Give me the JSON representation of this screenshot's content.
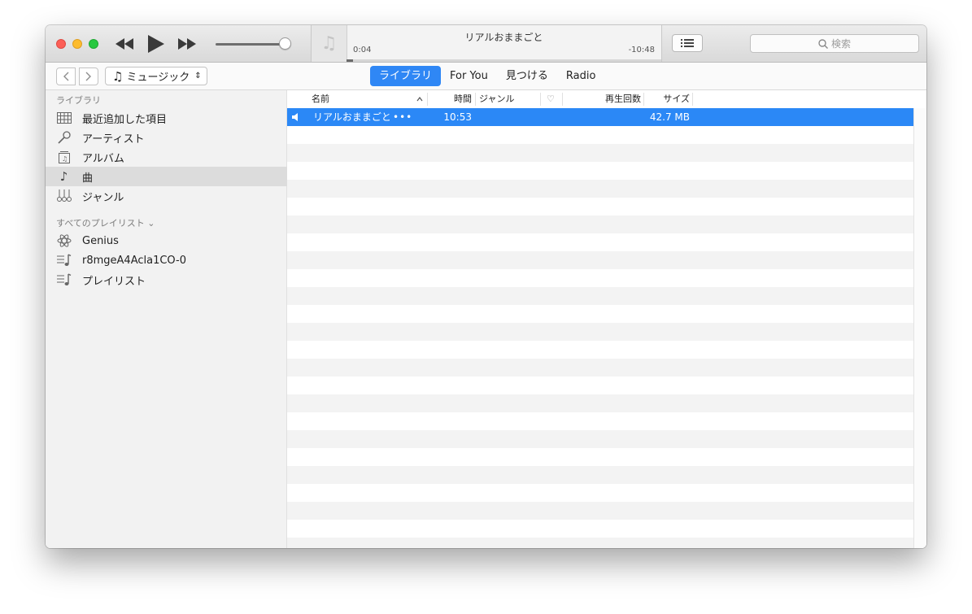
{
  "player": {
    "now_playing_title": "リアルおままごと",
    "elapsed": "0:04",
    "remaining": "-10:48",
    "progress": 0.006,
    "volume": 0.9
  },
  "search": {
    "placeholder": "検索"
  },
  "nav": {
    "media_kind": "ミュージック",
    "tabs": [
      {
        "label": "ライブラリ",
        "active": true
      },
      {
        "label": "For You",
        "active": false
      },
      {
        "label": "見つける",
        "active": false
      },
      {
        "label": "Radio",
        "active": false
      }
    ]
  },
  "sidebar": {
    "library_header": "ライブラリ",
    "library_items": [
      {
        "label": "最近追加した項目",
        "icon": "grid-icon"
      },
      {
        "label": "アーティスト",
        "icon": "microphone-icon"
      },
      {
        "label": "アルバム",
        "icon": "album-icon"
      },
      {
        "label": "曲",
        "icon": "music-note-icon",
        "selected": true
      },
      {
        "label": "ジャンル",
        "icon": "genre-icon"
      }
    ],
    "playlists_header": "すべてのプレイリスト ⌄",
    "playlists": [
      {
        "label": "Genius",
        "icon": "genius-atom-icon"
      },
      {
        "label": "r8mgeA4Acla1CO-0",
        "icon": "playlist-icon"
      },
      {
        "label": "プレイリスト",
        "icon": "playlist-icon"
      }
    ]
  },
  "table": {
    "columns": {
      "name": "名前",
      "time": "時間",
      "genre": "ジャンル",
      "love": "♡",
      "plays": "再生回数",
      "size": "サイズ"
    },
    "rows": [
      {
        "name": "リアルおままごと",
        "more": "•••",
        "time": "10:53",
        "genre": "",
        "plays": "",
        "size": "42.7 MB",
        "playing": true
      }
    ]
  },
  "colors": {
    "accent": "#2f87f5",
    "selection": "#2b88f6"
  }
}
